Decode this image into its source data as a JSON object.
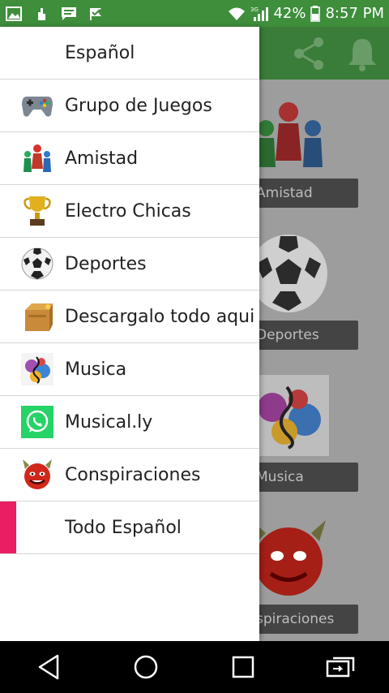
{
  "status_bar": {
    "battery": "42%",
    "time": "8:57 PM",
    "network": "3G",
    "icons": [
      "gallery-icon",
      "gesture-icon",
      "message-icon",
      "check-flag-icon",
      "wifi-icon",
      "signal-icon",
      "battery-icon"
    ]
  },
  "toolbar": {
    "actions": [
      "share-icon",
      "bell-icon"
    ]
  },
  "background_grid": [
    {
      "label": "Amistad"
    },
    {
      "label": "Deportes"
    },
    {
      "label": "Musica"
    },
    {
      "label": "spiraciones"
    }
  ],
  "drawer": {
    "header": "Español",
    "items": [
      {
        "label": "Grupo de Juegos",
        "icon": "gamepad-icon"
      },
      {
        "label": "Amistad",
        "icon": "friends-icon"
      },
      {
        "label": "Electro Chicas",
        "icon": "trophy-icon"
      },
      {
        "label": "Deportes",
        "icon": "soccer-ball-icon"
      },
      {
        "label": "Descargalo todo aqui",
        "icon": "box-icon"
      },
      {
        "label": "Musica",
        "icon": "music-icon"
      },
      {
        "label": "Musical.ly",
        "icon": "whatsapp-icon"
      },
      {
        "label": "Conspiraciones",
        "icon": "devil-icon"
      }
    ],
    "active_item": "Todo Español",
    "colors": {
      "active_marker": "#e91e63",
      "statusbar": "#3e8e3c"
    }
  },
  "nav_bar": {
    "buttons": [
      "back-icon",
      "home-icon",
      "recents-icon",
      "switch-icon"
    ]
  }
}
